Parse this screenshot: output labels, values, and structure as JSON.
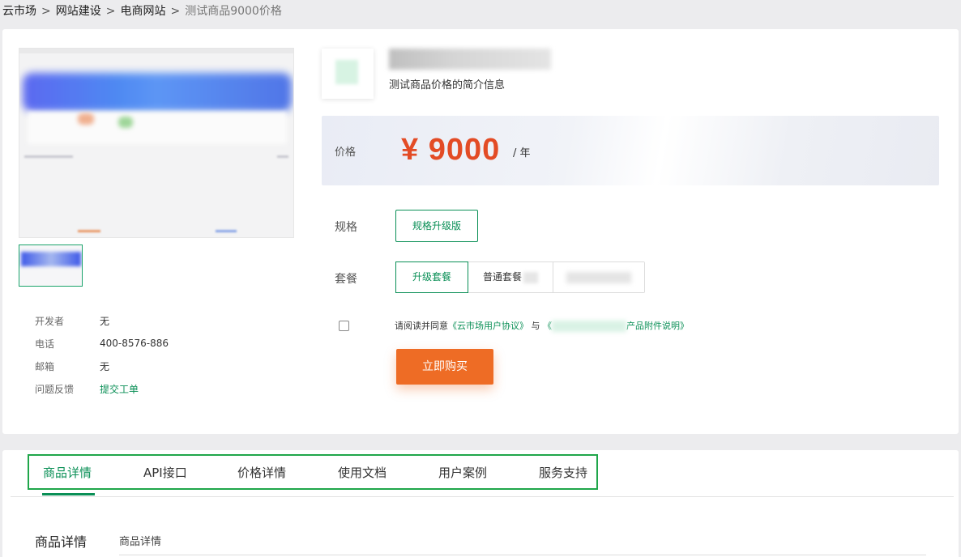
{
  "breadcrumb": {
    "items": [
      "云市场",
      "网站建设",
      "电商网站"
    ],
    "separator": ">",
    "current": "测试商品9000价格"
  },
  "product": {
    "subtitle": "测试商品价格的简介信息",
    "price_label": "价格",
    "price": "¥ 9000",
    "price_unit": "/ 年"
  },
  "vendor_info": [
    {
      "key": "开发者",
      "value": "无"
    },
    {
      "key": "电话",
      "value": "400-8576-886"
    },
    {
      "key": "邮箱",
      "value": "无"
    },
    {
      "key": "问题反馈",
      "value": "提交工单"
    }
  ],
  "spec": {
    "label": "规格",
    "options": [
      "规格升级版"
    ],
    "selected": "规格升级版"
  },
  "package": {
    "label": "套餐",
    "options": [
      "升级套餐",
      "普通套餐",
      ""
    ],
    "selected": "升级套餐"
  },
  "agreement": {
    "prefix": "请阅读并同意",
    "link1": "《云市场用户协议》",
    "joiner": "与",
    "link2_start": "《",
    "link2_end": "产品附件说明》",
    "checked": false
  },
  "buy_button": "立即购买",
  "tabs": {
    "items": [
      "商品详情",
      "API接口",
      "价格详情",
      "使用文档",
      "用户案例",
      "服务支持"
    ],
    "active": "商品详情"
  },
  "detail": {
    "heading": "商品详情",
    "sub": "商品详情"
  },
  "colors": {
    "accent_green": "#0a8f56",
    "price_red": "#e34b25",
    "buy_orange": "#ee6c25",
    "tab_border": "#1fa64a"
  }
}
